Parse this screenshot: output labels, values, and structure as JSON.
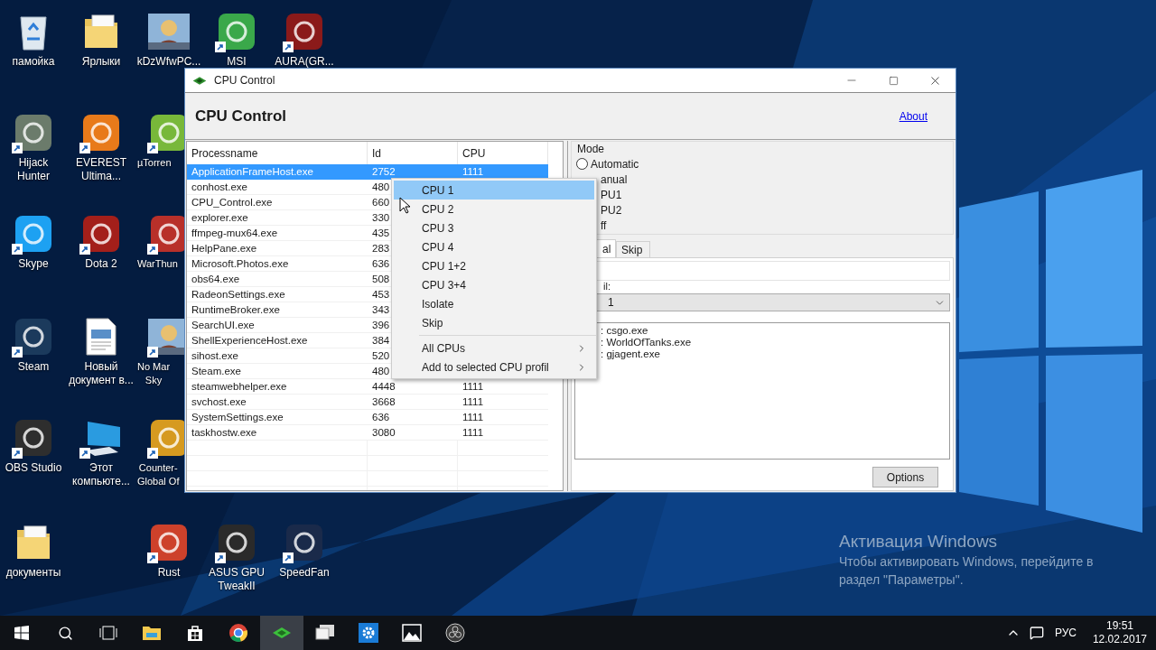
{
  "desktop_icons": [
    {
      "label": "памойка",
      "kind": "bin",
      "shortcut": false
    },
    {
      "label": "Hijack\nHunter",
      "kind": "app",
      "color": "#6b7b6b",
      "shortcut": true
    },
    {
      "label": "Skype",
      "kind": "app",
      "color": "#1da1f2",
      "shortcut": true
    },
    {
      "label": "Steam",
      "kind": "app",
      "color": "#1b3a5c",
      "shortcut": true
    },
    {
      "label": "OBS Studio",
      "kind": "app",
      "color": "#2e2e2e",
      "shortcut": true
    },
    {
      "label": "документы",
      "kind": "folder",
      "shortcut": false
    },
    {
      "label": "Ярлыки",
      "kind": "folder",
      "shortcut": false
    },
    {
      "label": "EVEREST\nUltima...",
      "kind": "app",
      "color": "#e87a1a",
      "shortcut": true
    },
    {
      "label": "Dota 2",
      "kind": "app",
      "color": "#a31f1a",
      "shortcut": true
    },
    {
      "label": "Новый\nдокумент в...",
      "kind": "document",
      "shortcut": false
    },
    {
      "label": "Этот\nкомпьюте...",
      "kind": "computer",
      "shortcut": true
    },
    {
      "label": "kDzWfwPC...",
      "kind": "picture",
      "shortcut": false
    },
    {
      "label": "µTorren",
      "kind": "app",
      "color": "#78b83a",
      "shortcut": true
    },
    {
      "label": "WarThun",
      "kind": "app",
      "color": "#b8302a",
      "shortcut": true
    },
    {
      "label": "No Mar\nSky",
      "kind": "picture",
      "shortcut": true
    },
    {
      "label": "Counter-\nGlobal Of",
      "kind": "app",
      "color": "#d69a20",
      "shortcut": true
    },
    {
      "label": "Rust",
      "kind": "app",
      "color": "#cd412b",
      "shortcut": true
    },
    {
      "label": "MSI",
      "kind": "app",
      "color": "#3aa84a",
      "shortcut": true
    },
    {
      "label": "ASUS GPU\nTweakII",
      "kind": "app",
      "color": "#2a2a2a",
      "shortcut": true
    },
    {
      "label": "AURA(GR...",
      "kind": "app",
      "color": "#8b1a1a",
      "shortcut": true
    },
    {
      "label": "SpeedFan",
      "kind": "app",
      "color": "#1a2a4a",
      "shortcut": true
    }
  ],
  "window": {
    "title": "CPU Control",
    "heading": "CPU Control",
    "about_link": "About"
  },
  "process_table": {
    "columns": [
      "Processname",
      "Id",
      "CPU"
    ],
    "rows": [
      {
        "name": "ApplicationFrameHost.exe",
        "id": "2752",
        "cpu": "1111",
        "selected": true
      },
      {
        "name": "conhost.exe",
        "id": "480",
        "selected": false
      },
      {
        "name": "CPU_Control.exe",
        "id": "660",
        "selected": false
      },
      {
        "name": "explorer.exe",
        "id": "330",
        "selected": false
      },
      {
        "name": "ffmpeg-mux64.exe",
        "id": "435",
        "selected": false
      },
      {
        "name": "HelpPane.exe",
        "id": "283",
        "selected": false
      },
      {
        "name": "Microsoft.Photos.exe",
        "id": "636",
        "selected": false
      },
      {
        "name": "obs64.exe",
        "id": "508",
        "selected": false
      },
      {
        "name": "RadeonSettings.exe",
        "id": "453",
        "selected": false
      },
      {
        "name": "RuntimeBroker.exe",
        "id": "343",
        "selected": false
      },
      {
        "name": "SearchUI.exe",
        "id": "396",
        "selected": false
      },
      {
        "name": "ShellExperienceHost.exe",
        "id": "384",
        "selected": false
      },
      {
        "name": "sihost.exe",
        "id": "520",
        "selected": false
      },
      {
        "name": "Steam.exe",
        "id": "480",
        "selected": false
      },
      {
        "name": "steamwebhelper.exe",
        "id": "4448",
        "cpu": "1111",
        "selected": false
      },
      {
        "name": "svchost.exe",
        "id": "3668",
        "cpu": "1111",
        "selected": false
      },
      {
        "name": "SystemSettings.exe",
        "id": "636",
        "cpu": "1111",
        "selected": false
      },
      {
        "name": "taskhostw.exe",
        "id": "3080",
        "cpu": "1111",
        "selected": false
      }
    ]
  },
  "context_menu": [
    {
      "label": "CPU 1",
      "kind": "item",
      "selected": true
    },
    {
      "label": "CPU 2",
      "kind": "item",
      "selected": false
    },
    {
      "label": "CPU 3",
      "kind": "item",
      "selected": false
    },
    {
      "label": "CPU 4",
      "kind": "item",
      "selected": false
    },
    {
      "label": "CPU 1+2",
      "kind": "item",
      "selected": false
    },
    {
      "label": "CPU 3+4",
      "kind": "item",
      "selected": false
    },
    {
      "label": "Isolate",
      "kind": "item",
      "selected": false
    },
    {
      "label": "Skip",
      "kind": "item",
      "selected": false
    },
    {
      "label": "All CPUs",
      "kind": "submenu",
      "selected": false
    },
    {
      "label": "Add to selected CPU profil",
      "kind": "submenu",
      "selected": false
    }
  ],
  "mode": {
    "title": "Mode",
    "options": [
      {
        "label": "Automatic",
        "selected": false
      }
    ],
    "partial_labels": [
      "anual",
      "PU1",
      "PU2",
      "ff"
    ]
  },
  "tabs": [
    {
      "label": "al",
      "selected": true
    },
    {
      "label": "Skip",
      "selected": false
    }
  ],
  "profile_label": "il:",
  "profile_select": {
    "value": "1"
  },
  "profile_list": [
    ": csgo.exe",
    ": WorldOfTanks.exe",
    ": gjagent.exe"
  ],
  "options_button": "Options",
  "activation": {
    "title": "Активация Windows",
    "text": "Чтобы активировать Windows, перейдите в раздел \"Параметры\"."
  },
  "taskbar": {
    "items": [
      {
        "kind": "start",
        "active": false
      },
      {
        "kind": "search",
        "active": false
      },
      {
        "kind": "taskview",
        "active": false
      },
      {
        "kind": "explorer",
        "active": false
      },
      {
        "kind": "store",
        "active": false
      },
      {
        "kind": "browser",
        "active": false
      },
      {
        "kind": "chip",
        "active": true
      },
      {
        "kind": "monitor",
        "active": false
      },
      {
        "kind": "settings",
        "active": false
      },
      {
        "kind": "photos",
        "active": false
      },
      {
        "kind": "obs",
        "active": false
      }
    ],
    "tray": {
      "language": "РУС",
      "time": "19:51",
      "date": "12.02.2017"
    }
  }
}
